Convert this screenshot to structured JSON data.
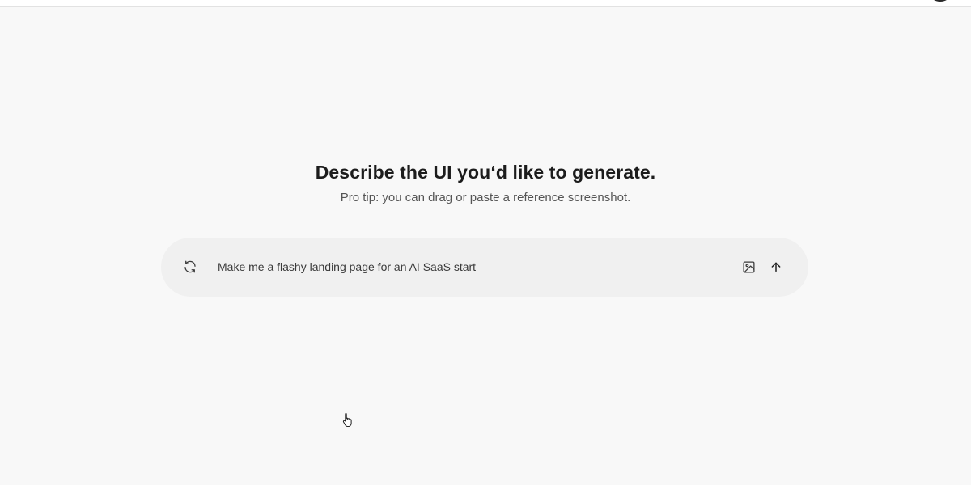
{
  "header": {
    "avatar_icon": "avatar-icon"
  },
  "main": {
    "heading": "Describe the UI you‘d like to generate.",
    "subheading": "Pro tip: you can drag or paste a reference screenshot."
  },
  "prompt": {
    "value": "Make me a flashy landing page for an AI SaaS start",
    "refresh_icon": "refresh-icon",
    "image_icon": "image-icon",
    "submit_icon": "arrow-up-icon"
  },
  "pointer": {
    "icon": "hand-pointer-icon"
  },
  "colors": {
    "background": "#f8f8f8",
    "prompt_bar": "#f0f0f0",
    "text": "#1c1c1c",
    "muted_text": "#555555"
  }
}
